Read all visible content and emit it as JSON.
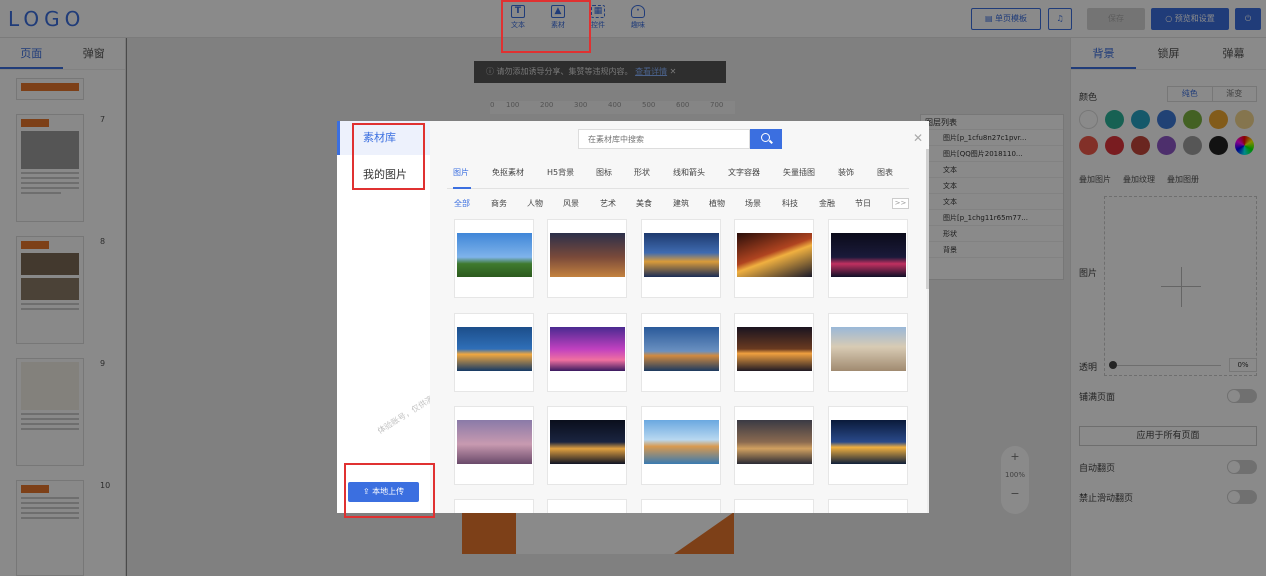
{
  "header": {
    "logo": "LOGO",
    "tools": [
      {
        "label": "文本",
        "icon": "text-icon"
      },
      {
        "label": "素材",
        "icon": "image-icon"
      },
      {
        "label": "控件",
        "icon": "widget-icon"
      },
      {
        "label": "趣味",
        "icon": "bulb-icon"
      }
    ],
    "single_template_label": "单页模板",
    "save_label": "保存",
    "preview_label": "预览和设置"
  },
  "left_panel": {
    "tabs": [
      "页面",
      "弹窗"
    ],
    "page_numbers": [
      "7",
      "8",
      "9",
      "10"
    ]
  },
  "notice": {
    "text": "请勿添加诱导分享、集赞等违规内容。",
    "link": "查看详情"
  },
  "ruler_ticks": [
    "0",
    "100",
    "200",
    "300",
    "400",
    "500",
    "600",
    "700"
  ],
  "layer_panel": {
    "title": "图层列表",
    "items": [
      "图片[p_1cfu8n27c1pvr...",
      "图片[QQ图片2018110...",
      "文本",
      "文本",
      "文本",
      "图片[p_1chg11r65m77...",
      "形状",
      "背景"
    ]
  },
  "zoom": {
    "value": "100%",
    "plus": "+",
    "minus": "−"
  },
  "right_panel": {
    "tabs": [
      "背景",
      "锁屏",
      "弹幕"
    ],
    "color_label": "颜色",
    "solid_label": "纯色",
    "gradient_label": "渐变",
    "swatches": [
      "#ffffff",
      "#2bb39a",
      "#27a3c4",
      "#3d7ad8",
      "#7cb342",
      "#f0a830",
      "#f5d890",
      "#f05a4a",
      "#e0353b",
      "#c4473b",
      "#8f57c8",
      "#a0a0a0",
      "#222222",
      "#ff00ff"
    ],
    "subtabs": [
      "叠加图片",
      "叠加纹理",
      "叠加图册"
    ],
    "image_label": "图片",
    "opacity_label": "透明",
    "opacity_value": "0%",
    "fill_page_label": "铺满页面",
    "apply_all_label": "应用于所有页面",
    "auto_flip_label": "自动翻页",
    "disable_swipe_label": "禁止滑动翻页"
  },
  "modal": {
    "side_items": [
      "素材库",
      "我的图片"
    ],
    "search_placeholder": "在素材库中搜索",
    "categories": [
      "图片",
      "免抠素材",
      "H5背景",
      "图标",
      "形状",
      "线和箭头",
      "文字容器",
      "矢量插图",
      "装饰",
      "图表"
    ],
    "subcategories": [
      "全部",
      "商务",
      "人物",
      "风景",
      "艺术",
      "美食",
      "建筑",
      "植物",
      "场景",
      "科技",
      "金融",
      "节日"
    ],
    "more_label": ">>",
    "upload_label": "本地上传",
    "watermark": "体验账号，仅供演示与试用",
    "images": [
      {
        "name": "eiffel-tower-photo"
      },
      {
        "name": "paris-night-aerial-photo"
      },
      {
        "name": "city-harbor-night-photo"
      },
      {
        "name": "highway-lights-night-photo"
      },
      {
        "name": "tv-tower-skyline-night-photo"
      },
      {
        "name": "skyline-reflection-photo"
      },
      {
        "name": "purple-skyscraper-photo"
      },
      {
        "name": "riverside-city-dusk-photo"
      },
      {
        "name": "city-lights-aerial-photo"
      },
      {
        "name": "classical-building-photo"
      },
      {
        "name": "shanghai-skyline-photo"
      },
      {
        "name": "night-city-panorama-photo"
      },
      {
        "name": "waterfront-town-photo"
      },
      {
        "name": "venice-canal-photo"
      },
      {
        "name": "light-trails-road-photo"
      }
    ]
  }
}
